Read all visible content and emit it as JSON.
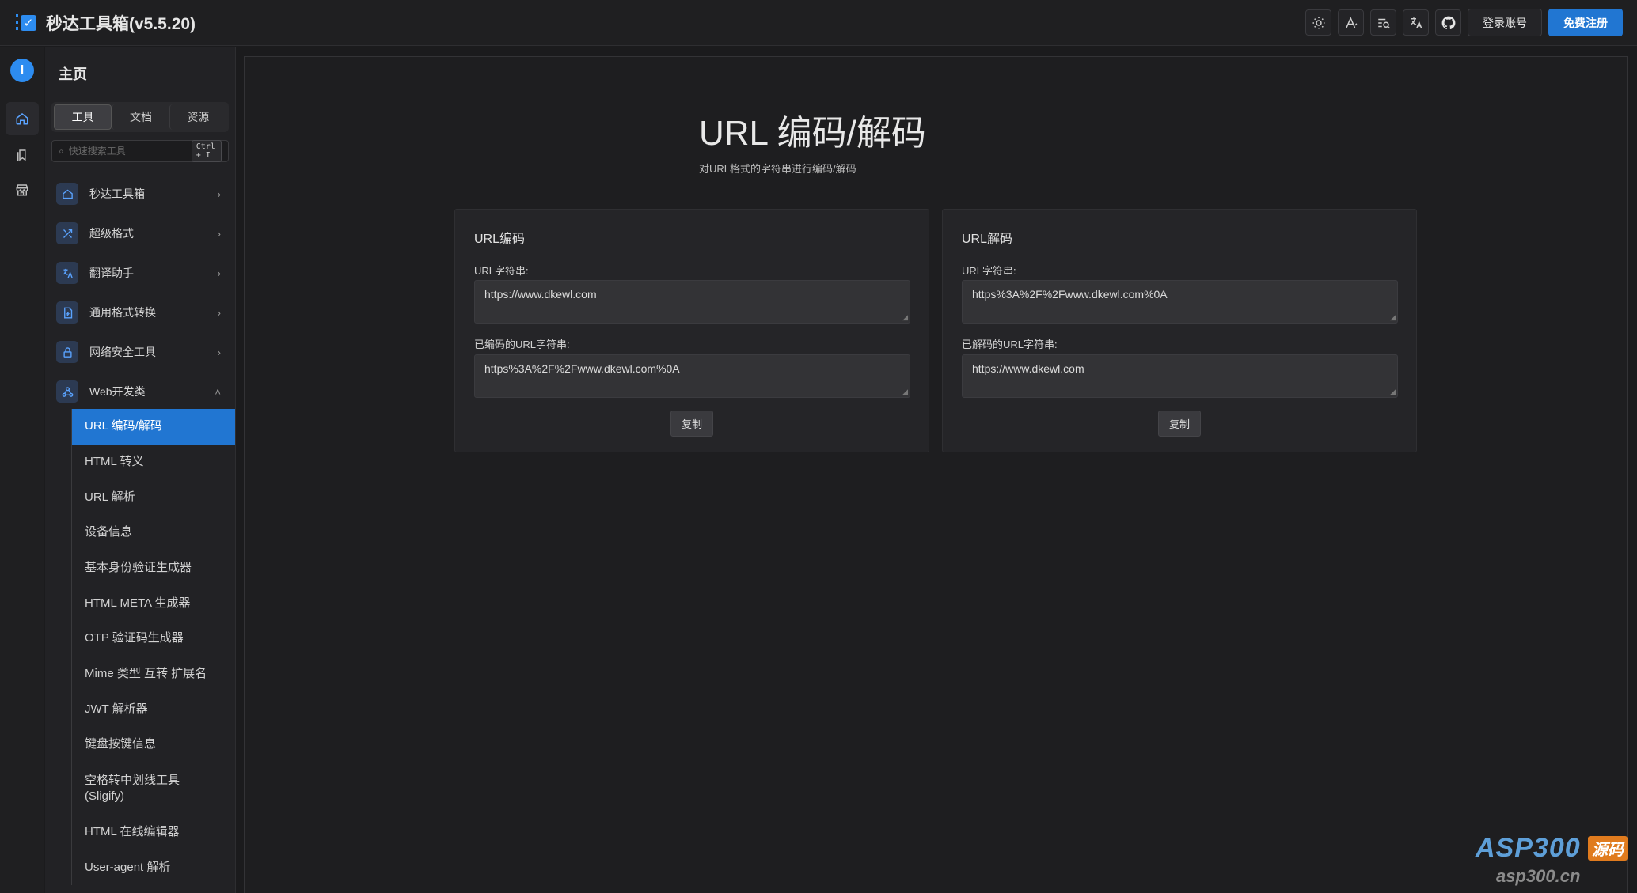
{
  "header": {
    "app_title": "秒达工具箱(v5.5.20)",
    "icons": [
      "sun-icon",
      "font-icon",
      "search-list-icon",
      "translate-icon",
      "github-icon"
    ],
    "login_label": "登录账号",
    "register_label": "免费注册",
    "accent": "#2176d2"
  },
  "rail": {
    "logo_char": "I",
    "items": [
      "home-icon",
      "bookmark-icon",
      "store-icon"
    ]
  },
  "sidebar": {
    "title": "主页",
    "tabs": [
      "工具",
      "文档",
      "资源"
    ],
    "active_tab": "工具",
    "search": {
      "placeholder": "快速搜索工具",
      "shortcut": "Ctrl + I"
    },
    "categories": [
      {
        "label": "秒达工具箱",
        "icon": "home-icon",
        "expanded": false
      },
      {
        "label": "超级格式",
        "icon": "tools-icon",
        "expanded": false
      },
      {
        "label": "翻译助手",
        "icon": "translate-icon",
        "expanded": false
      },
      {
        "label": "通用格式转换",
        "icon": "file-convert-icon",
        "expanded": false
      },
      {
        "label": "网络安全工具",
        "icon": "lock-icon",
        "expanded": false
      },
      {
        "label": "Web开发类",
        "icon": "webhook-icon",
        "expanded": true
      }
    ],
    "web_tools": [
      "URL 编码/解码",
      "HTML 转义",
      "URL 解析",
      "设备信息",
      "基本身份验证生成器",
      "HTML META 生成器",
      "OTP 验证码生成器",
      "Mime 类型 互转 扩展名",
      "JWT 解析器",
      "键盘按键信息",
      "空格转中划线工具 (Sligify)",
      "HTML 在线编辑器",
      "User-agent 解析"
    ],
    "active_tool": "URL 编码/解码"
  },
  "main": {
    "title": "URL 编码/解码",
    "description": "对URL格式的字符串进行编码/解码",
    "encode_card": {
      "title": "URL编码",
      "input_label": "URL字符串:",
      "input_value": "https://www.dkewl.com",
      "output_label": "已编码的URL字符串:",
      "output_value": "https%3A%2F%2Fwww.dkewl.com%0A",
      "copy_label": "复制"
    },
    "decode_card": {
      "title": "URL解码",
      "input_label": "URL字符串:",
      "input_value": "https%3A%2F%2Fwww.dkewl.com%0A",
      "output_label": "已解码的URL字符串:",
      "output_value": "https://www.dkewl.com",
      "copy_label": "复制"
    }
  },
  "watermark": {
    "top": "ASP300",
    "badge": "源码",
    "bottom": "asp300.cn"
  }
}
